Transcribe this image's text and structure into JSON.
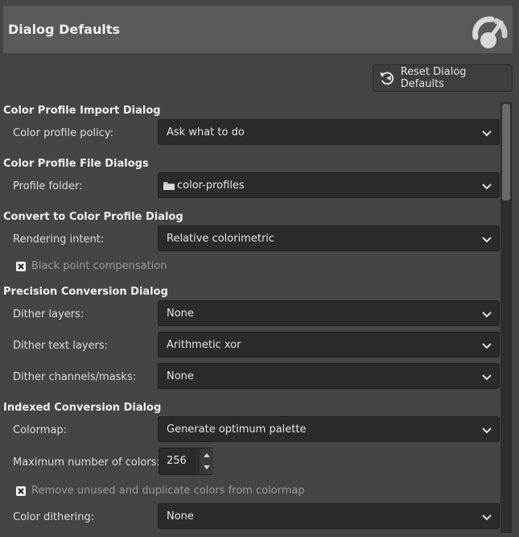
{
  "header": {
    "title": "Dialog Defaults",
    "icon": "gauge-icon"
  },
  "reset_button": {
    "label": "Reset Dialog Defaults",
    "icon": "reset-icon"
  },
  "sections": [
    {
      "title": "Color Profile Import Dialog",
      "rows": [
        {
          "label": "Color profile policy:",
          "value": "Ask what to do"
        }
      ]
    },
    {
      "title": "Color Profile File Dialogs",
      "rows": [
        {
          "label": "Profile folder:",
          "value": "color-profiles",
          "icon": "folder-icon"
        }
      ]
    },
    {
      "title": "Convert to Color Profile Dialog",
      "rows": [
        {
          "label": "Rendering intent:",
          "value": "Relative colorimetric"
        }
      ],
      "checkbox": {
        "label": "Black point compensation",
        "checked": true
      }
    },
    {
      "title": "Precision Conversion Dialog",
      "rows": [
        {
          "label": "Dither layers:",
          "value": "None"
        },
        {
          "label": "Dither text layers:",
          "value": "Arithmetic xor"
        },
        {
          "label": "Dither channels/masks:",
          "value": "None"
        }
      ]
    },
    {
      "title": "Indexed Conversion Dialog",
      "rows": [
        {
          "label": "Colormap:",
          "value": "Generate optimum palette"
        }
      ],
      "spin": {
        "label": "Maximum number of colors:",
        "value": "256"
      },
      "checkbox": {
        "label": "Remove unused and duplicate colors from colormap",
        "checked": true
      },
      "rows2": [
        {
          "label": "Color dithering:",
          "value": "None"
        }
      ]
    }
  ],
  "colors": {
    "background": "#454545",
    "header": "#5a5a5a",
    "input": "#2b2b2b"
  }
}
